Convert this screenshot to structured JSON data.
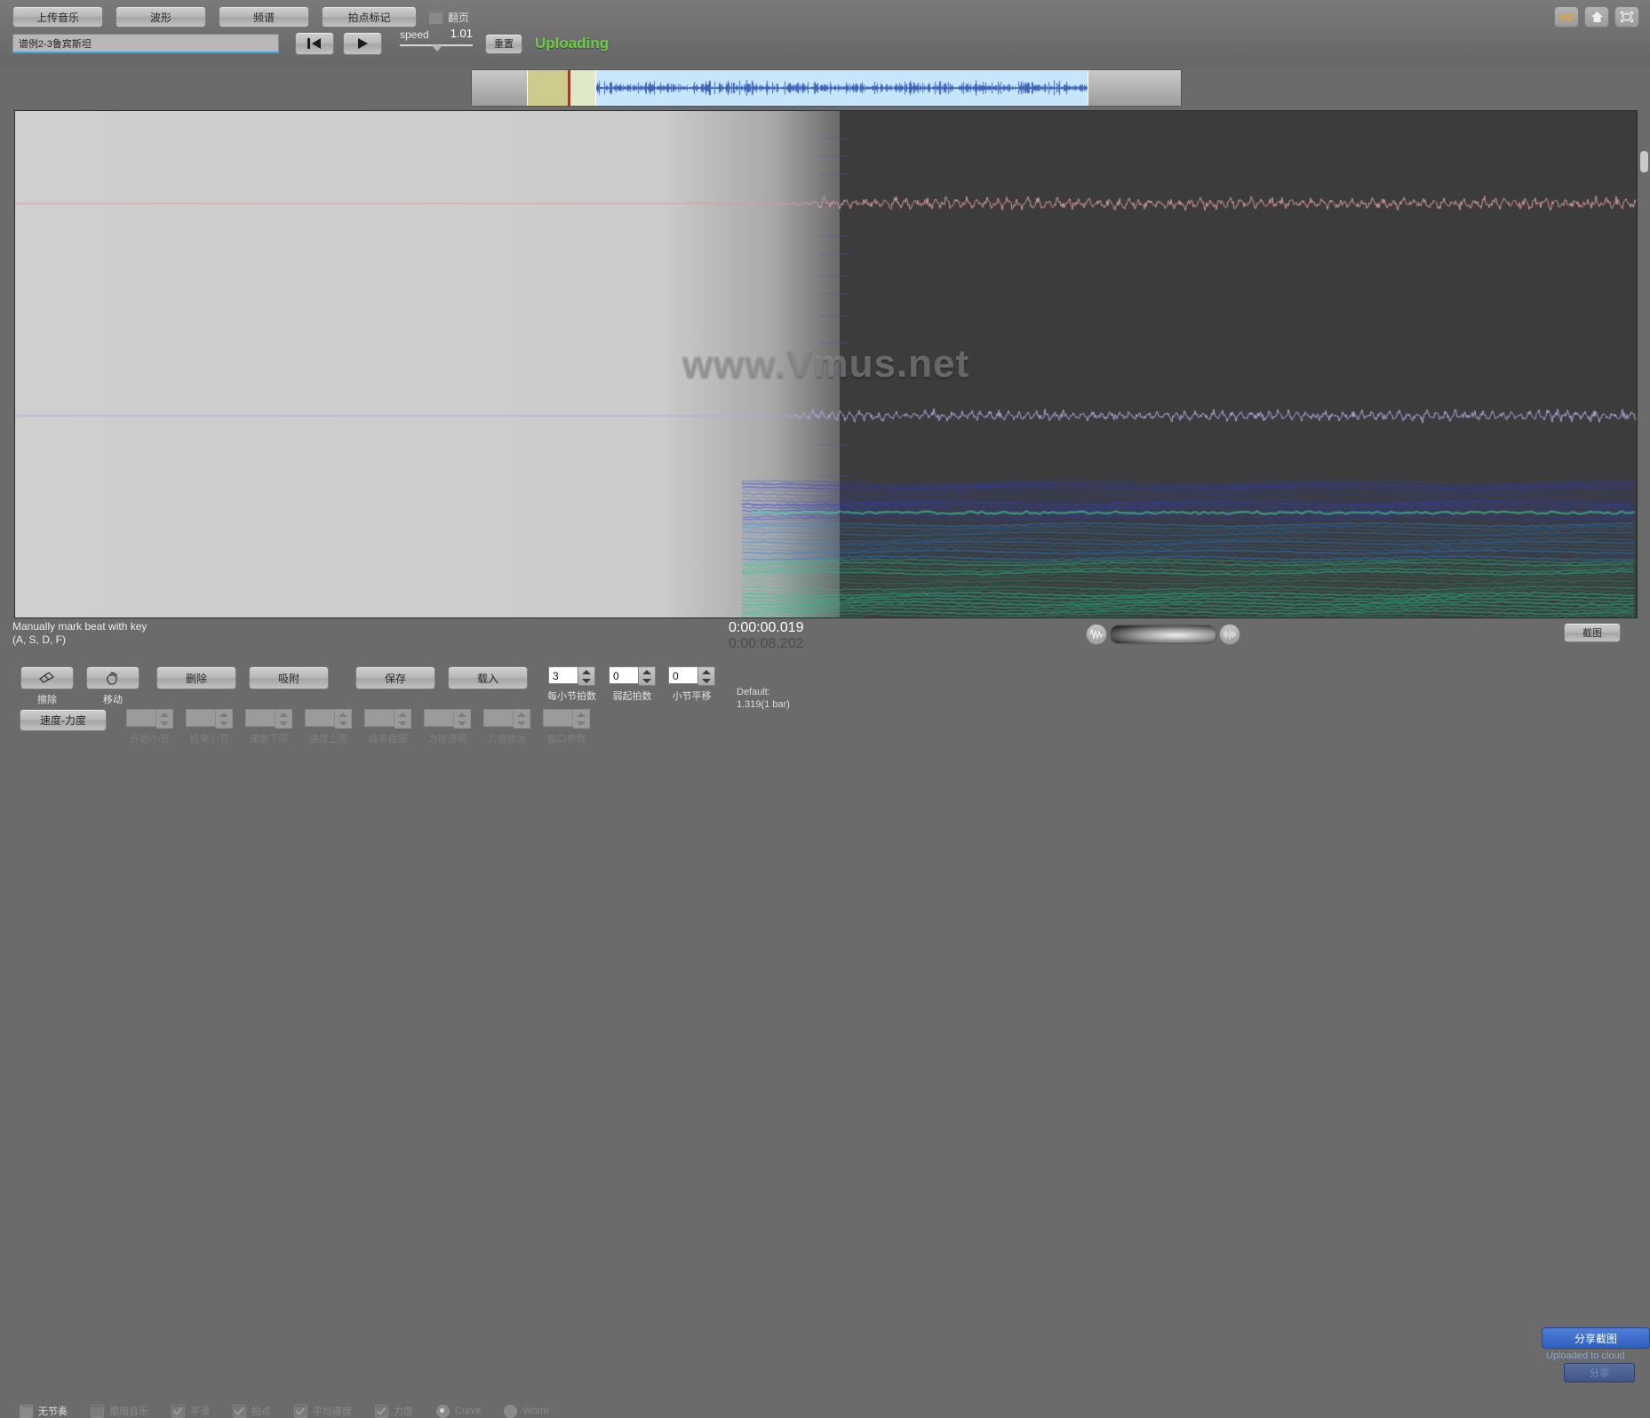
{
  "toolbar": {
    "upload_music": "上传音乐",
    "waveform": "波形",
    "spectrum": "频谱",
    "beat_mark": "拍点标记",
    "page_turn_label": "翻页",
    "page_turn_checked": false
  },
  "file": {
    "name": "谱例2-3鲁宾斯坦",
    "placeholder": "谱例2-3鲁宾斯坦"
  },
  "transport": {
    "rewind_icon": "skip-to-start-icon",
    "play_icon": "play-icon",
    "speed_label": "speed",
    "speed_value": "1.01",
    "reset_label": "重置",
    "status": "Uploading",
    "status_color": "#67cf3f"
  },
  "corner": {
    "version_badge": "V2",
    "home_icon": "home-icon",
    "fullscreen_icon": "fullscreen-icon"
  },
  "watermark": "www.Vmus.net",
  "status": {
    "hint_line1": "Manually mark beat with key",
    "hint_line2": "(A, S, D, F)",
    "time_current": "0:00:00.019",
    "time_total": "0:00:08.202",
    "capture_label": "截图",
    "zoom_out_icon": "waveform-wide-icon",
    "zoom_in_icon": "waveform-dense-icon"
  },
  "tools": [
    {
      "name": "eraser",
      "icon": "eraser-icon",
      "label": "擦除"
    },
    {
      "name": "move",
      "icon": "hand-icon",
      "label": "移动"
    }
  ],
  "actions": [
    {
      "name": "delete",
      "label": "删除"
    },
    {
      "name": "snap",
      "label": "吸附"
    },
    {
      "name": "save",
      "label": "保存"
    },
    {
      "name": "load",
      "label": "载入"
    }
  ],
  "spinners_row1": [
    {
      "name": "beats-per-bar",
      "label": "每小节拍数",
      "value": "3",
      "disabled": false
    },
    {
      "name": "pickup-beats",
      "label": "弱起拍数",
      "value": "0",
      "disabled": false
    },
    {
      "name": "bar-shift",
      "label": "小节平移",
      "value": "0",
      "disabled": false
    }
  ],
  "default_note": {
    "line1": "Default:",
    "line2": "1.319(1 bar)"
  },
  "tempo_button": "速度-力度",
  "spinners_row2": [
    {
      "name": "start-bar",
      "label": "开始小节",
      "value": "",
      "disabled": true
    },
    {
      "name": "end-bar",
      "label": "结束小节",
      "value": "",
      "disabled": true
    },
    {
      "name": "tempo-min",
      "label": "速度下限",
      "value": "",
      "disabled": true
    },
    {
      "name": "tempo-max",
      "label": "速度上限",
      "value": "",
      "disabled": true
    },
    {
      "name": "line-thickness",
      "label": "线条粗细",
      "value": "",
      "disabled": true
    },
    {
      "name": "dynamics-opacity",
      "label": "力度透明",
      "value": "",
      "disabled": true
    },
    {
      "name": "dynamics-scale",
      "label": "力度放大",
      "value": "",
      "disabled": true
    },
    {
      "name": "window-params",
      "label": "窗口参数",
      "value": "",
      "disabled": true
    }
  ],
  "checkboxes": [
    {
      "name": "no-metronome",
      "label": "无节奏",
      "type": "checkbox",
      "checked": false,
      "disabled": false
    },
    {
      "name": "follow-music",
      "label": "跟随音乐",
      "type": "checkbox",
      "checked": false,
      "disabled": true
    },
    {
      "name": "smooth",
      "label": "平滑",
      "type": "checkbox",
      "checked": true,
      "disabled": true
    },
    {
      "name": "beats",
      "label": "拍点",
      "type": "checkbox",
      "checked": true,
      "disabled": true
    },
    {
      "name": "average-tempo",
      "label": "平均速度",
      "type": "checkbox",
      "checked": true,
      "disabled": true
    },
    {
      "name": "dynamics",
      "label": "力度",
      "type": "checkbox",
      "checked": true,
      "disabled": true
    },
    {
      "name": "curve",
      "label": "Curve",
      "type": "radio",
      "checked": true,
      "disabled": true
    },
    {
      "name": "worm",
      "label": "Worm",
      "type": "radio",
      "checked": false,
      "disabled": true
    }
  ],
  "share": {
    "share_capture": "分享截图",
    "upload_note": "Uploaded to cloud",
    "share_button": "分享"
  }
}
